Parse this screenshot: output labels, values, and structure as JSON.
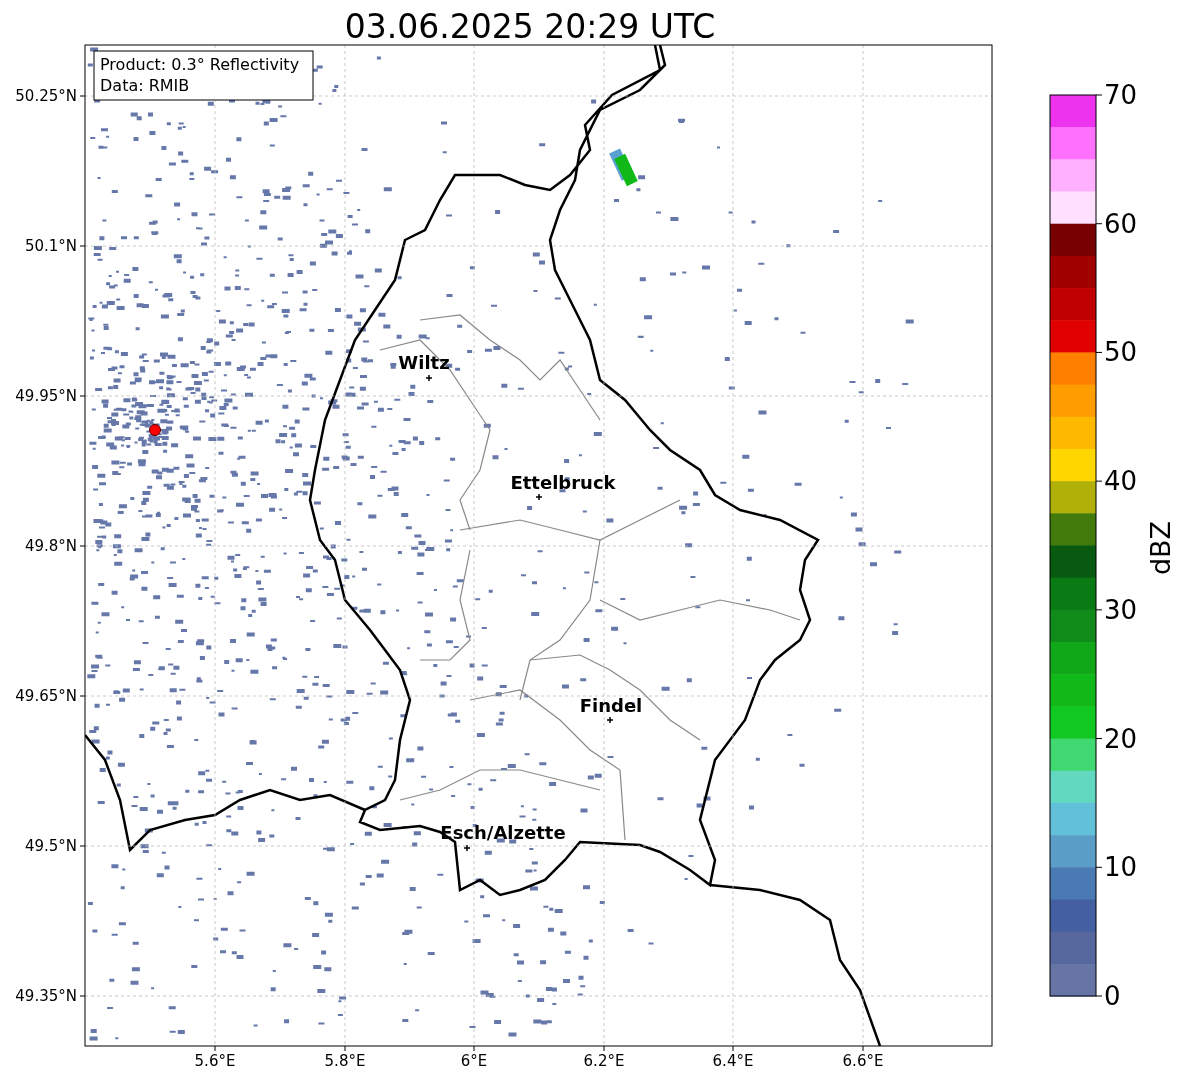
{
  "title": "03.06.2025 20:29 UTC",
  "info_box": {
    "lines": [
      "Product: 0.3° Reflectivity",
      "Data: RMIB"
    ]
  },
  "map": {
    "x_ticks": [
      "5.6°E",
      "5.8°E",
      "6°E",
      "6.2°E",
      "6.4°E",
      "6.6°E"
    ],
    "y_ticks": [
      "50.25°N",
      "50.1°N",
      "49.95°N",
      "49.8°N",
      "49.65°N",
      "49.5°N",
      "49.35°N"
    ],
    "cities": [
      {
        "name": "Wiltz"
      },
      {
        "name": "Ettelbruck"
      },
      {
        "name": "Findel"
      },
      {
        "name": "Esch/Alzette"
      }
    ],
    "radar_site": {
      "color": "#ff0000"
    }
  },
  "colorbar": {
    "label": "dBZ",
    "ticks": [
      "70",
      "60",
      "50",
      "40",
      "30",
      "20",
      "10",
      "0"
    ],
    "segments": [
      {
        "color": "#ee33ee"
      },
      {
        "color": "#ff70ff"
      },
      {
        "color": "#ffb0ff"
      },
      {
        "color": "#ffe0ff"
      },
      {
        "color": "#780000"
      },
      {
        "color": "#a00000"
      },
      {
        "color": "#c00000"
      },
      {
        "color": "#e00000"
      },
      {
        "color": "#ff7f00"
      },
      {
        "color": "#ff9c00"
      },
      {
        "color": "#ffb800"
      },
      {
        "color": "#ffd700"
      },
      {
        "color": "#b0b008"
      },
      {
        "color": "#437a0c"
      },
      {
        "color": "#085a10"
      },
      {
        "color": "#0a7a14"
      },
      {
        "color": "#108a18"
      },
      {
        "color": "#10a818"
      },
      {
        "color": "#10b818"
      },
      {
        "color": "#10c820"
      },
      {
        "color": "#40d870"
      },
      {
        "color": "#62d8c0"
      },
      {
        "color": "#62c0d8"
      },
      {
        "color": "#5a9ec8"
      },
      {
        "color": "#4a7ab3"
      },
      {
        "color": "#4560a2"
      },
      {
        "color": "#56679e"
      },
      {
        "color": "#6674a6"
      }
    ]
  }
}
